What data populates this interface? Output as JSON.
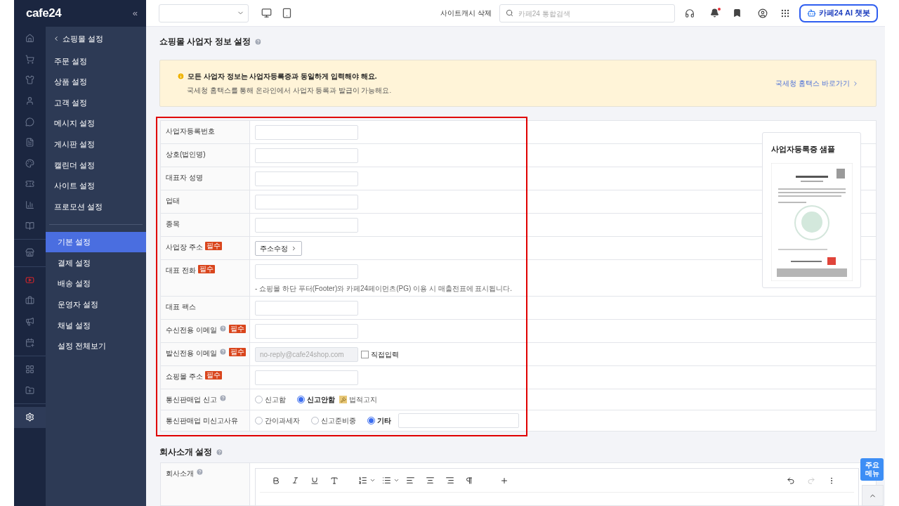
{
  "brand": {
    "logo": "cafe24",
    "collapse": "«"
  },
  "rail": [
    [
      {
        "kind": "home",
        "selected": false
      },
      {
        "kind": "cart",
        "selected": false
      },
      {
        "kind": "shirt",
        "selected": false
      },
      {
        "kind": "user",
        "selected": false
      },
      {
        "kind": "message",
        "selected": false
      },
      {
        "kind": "board",
        "selected": false
      },
      {
        "kind": "palette",
        "selected": false
      },
      {
        "kind": "ticket",
        "selected": false
      },
      {
        "kind": "chart",
        "selected": false
      },
      {
        "kind": "book",
        "selected": false
      }
    ],
    [
      {
        "kind": "store",
        "selected": false
      }
    ],
    [
      {
        "kind": "video",
        "selected": false
      },
      {
        "kind": "shop",
        "selected": false
      },
      {
        "kind": "megaphone",
        "selected": false
      },
      {
        "kind": "calendar",
        "selected": false
      }
    ],
    [
      {
        "kind": "apps",
        "selected": false
      },
      {
        "kind": "folder",
        "selected": false
      }
    ],
    [
      {
        "kind": "gear",
        "selected": true
      }
    ]
  ],
  "menu": {
    "back": "쇼핑몰 설정",
    "groups": [
      [
        {
          "label": "주문 설정",
          "selected": false
        },
        {
          "label": "상품 설정",
          "selected": false
        },
        {
          "label": "고객 설정",
          "selected": false
        },
        {
          "label": "메시지 설정",
          "selected": false
        },
        {
          "label": "게시판 설정",
          "selected": false
        },
        {
          "label": "캘린더 설정",
          "selected": false
        },
        {
          "label": "사이트 설정",
          "selected": false
        },
        {
          "label": "프로모션 설정",
          "selected": false
        }
      ],
      [
        {
          "label": "기본 설정",
          "selected": true
        },
        {
          "label": "결제 설정",
          "selected": false
        },
        {
          "label": "배송 설정",
          "selected": false
        },
        {
          "label": "운영자 설정",
          "selected": false
        },
        {
          "label": "채널 설정",
          "selected": false
        },
        {
          "label": "설정 전체보기",
          "selected": false
        }
      ]
    ]
  },
  "header": {
    "cache_button": "사이트캐시 삭제",
    "search": {
      "placeholder": "카페24 통합검색"
    },
    "notification_dot": true,
    "chatbot": "카페24 AI 챗봇"
  },
  "page_title": "쇼핑몰 사업자 정보 설정",
  "notice": {
    "title": "모든 사업자 정보는 사업자등록증과 동일하게 입력해야 해요.",
    "text": "국세청 홈택스를 통해 온라인에서 사업자 등록과 발급이 가능해요.",
    "link": "국세청 홈택스 바로가기"
  },
  "form": {
    "rows": [
      {
        "kind": "input",
        "label": "사업자등록번호",
        "help": false
      },
      {
        "kind": "input",
        "label": "상호(법인명)",
        "help": false
      },
      {
        "kind": "input",
        "label": "대표자 성명",
        "help": false
      },
      {
        "kind": "input",
        "label": "업태",
        "help": false
      },
      {
        "kind": "input",
        "label": "종목",
        "help": false
      },
      {
        "kind": "button",
        "label": "사업장 주소",
        "help": false,
        "badge": "필수",
        "button": "주소수정"
      },
      {
        "kind": "input",
        "label": "대표 전화",
        "help": false,
        "badge": "필수",
        "note": "- 쇼핑몰 하단 푸터(Footer)와 카페24페이먼츠(PG) 이용 시 매출전표에 표시됩니다."
      },
      {
        "kind": "input",
        "label": "대표 팩스",
        "help": false
      },
      {
        "kind": "input",
        "label": "수신전용 이메일",
        "help": true,
        "badge": "필수"
      },
      {
        "kind": "input",
        "label": "발신전용 이메일",
        "help": true,
        "badge": "필수",
        "disabled": true,
        "value": "no-reply@cafe24shop.com",
        "checkbox": {
          "label": "직접입력",
          "checked": false
        }
      },
      {
        "kind": "input",
        "label": "쇼핑몰 주소",
        "help": false,
        "badge": "필수"
      },
      {
        "kind": "radios",
        "label": "통신판매업 신고",
        "help": true,
        "options": [
          {
            "label": "신고함",
            "selected": false
          },
          {
            "label": "신고안함",
            "selected": true
          }
        ],
        "link": "법적고지"
      },
      {
        "kind": "radios",
        "label": "통신판매업 미신고사유",
        "help": false,
        "options": [
          {
            "label": "간이과세자",
            "selected": false
          },
          {
            "label": "신고준비중",
            "selected": false
          },
          {
            "label": "기타",
            "selected": true
          }
        ],
        "other_field": true
      }
    ]
  },
  "sample": {
    "title": "사업자등록증 샘플"
  },
  "intro": {
    "title": "회사소개 설정",
    "label": "회사소개"
  },
  "floating_menu": "주요 메뉴"
}
